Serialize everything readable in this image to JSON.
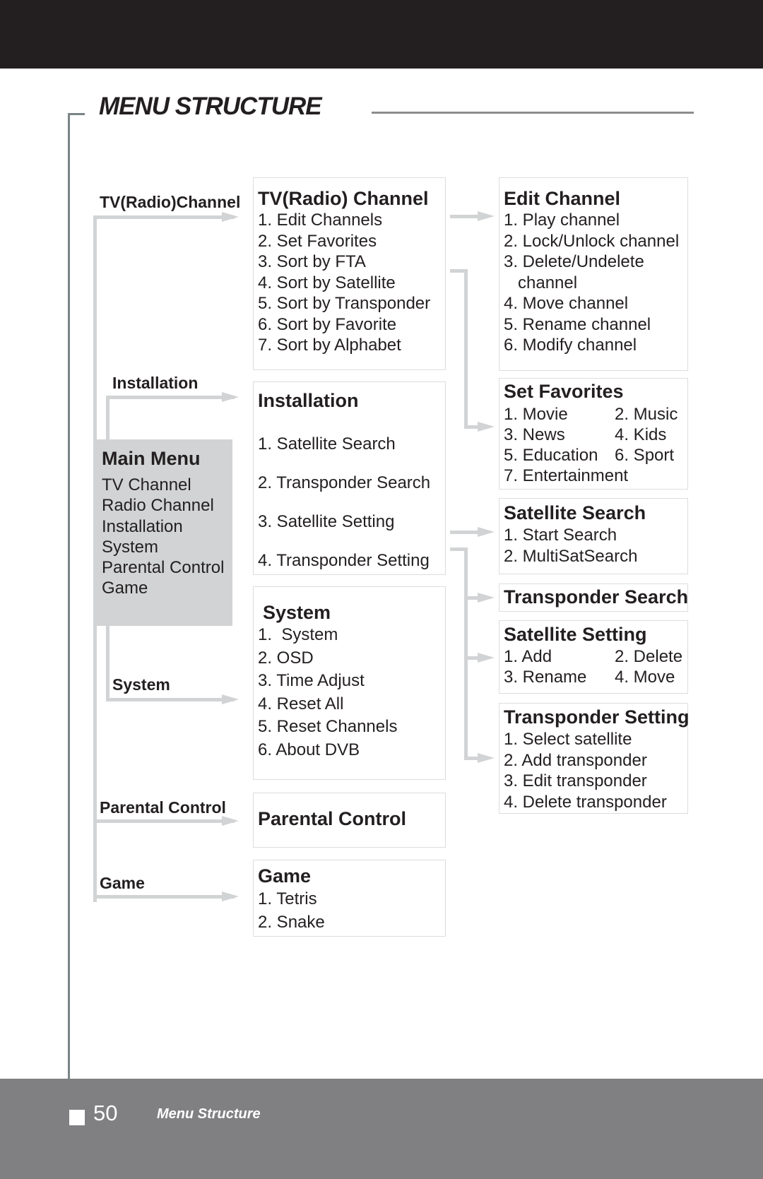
{
  "header": {
    "title": "MENU STRUCTURE"
  },
  "main_menu": {
    "title": "Main Menu",
    "items": [
      "TV Channel",
      "Radio Channel",
      "Installation",
      "System",
      "Parental Control",
      "Game"
    ]
  },
  "branch_labels": {
    "tv_radio": "TV(Radio)Channel",
    "installation": "Installation",
    "system": "System",
    "parental": "Parental Control",
    "game": "Game"
  },
  "middle": {
    "tv_radio": {
      "title": "TV(Radio) Channel",
      "items": [
        "1. Edit Channels",
        "2. Set Favorites",
        "3. Sort by FTA",
        "4. Sort by Satellite",
        "5. Sort by Transponder",
        "6. Sort by Favorite",
        "7. Sort by Alphabet"
      ]
    },
    "installation": {
      "title": "Installation",
      "items": [
        "1. Satellite Search",
        "2. Transponder Search",
        "3. Satellite Setting",
        "4. Transponder Setting"
      ]
    },
    "system": {
      "title": "System",
      "items": [
        "1.  System",
        "2. OSD",
        "3. Time Adjust",
        "4. Reset All",
        "5. Reset Channels",
        "6. About DVB"
      ]
    },
    "parental": {
      "title": "Parental Control"
    },
    "game": {
      "title": "Game",
      "items": [
        "1. Tetris",
        "2. Snake"
      ]
    }
  },
  "right": {
    "edit_channel": {
      "title": "Edit Channel",
      "items": [
        "1. Play channel",
        "2. Lock/Unlock channel",
        "3. Delete/Undelete",
        "   channel",
        "4. Move channel",
        "5. Rename channel",
        "6. Modify channel"
      ]
    },
    "set_favorites": {
      "title": "Set Favorites",
      "items": [
        "1. Movie",
        "2. Music",
        "3. News",
        "4. Kids",
        "5. Education",
        "6. Sport",
        "7. Entertainment"
      ]
    },
    "satellite_search": {
      "title": "Satellite Search",
      "items": [
        "1. Start Search",
        "2. MultiSatSearch"
      ]
    },
    "transponder_search": {
      "title": "Transponder Search"
    },
    "satellite_setting": {
      "title": "Satellite Setting",
      "items": [
        "1. Add",
        "2. Delete",
        "3. Rename",
        "4. Move"
      ]
    },
    "transponder_setting": {
      "title": "Transponder Setting",
      "items": [
        "1. Select satellite",
        "2. Add transponder",
        "3. Edit transponder",
        "4. Delete transponder"
      ]
    }
  },
  "footer": {
    "page_number": "50",
    "section": "Menu Structure"
  }
}
